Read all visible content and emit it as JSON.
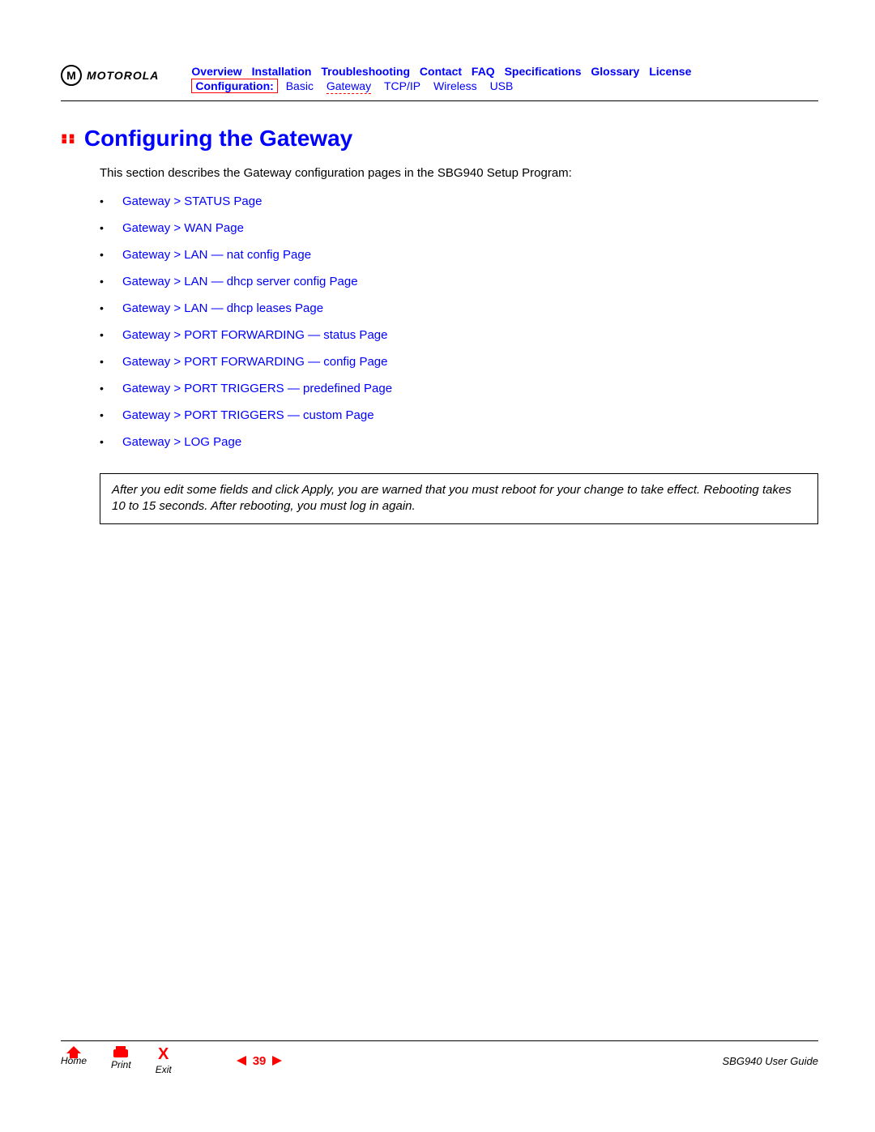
{
  "brand": "MOTOROLA",
  "nav": {
    "row1": [
      "Overview",
      "Installation",
      "Troubleshooting",
      "Contact",
      "FAQ",
      "Specifications",
      "Glossary",
      "License"
    ],
    "config_label": "Configuration:",
    "row2": [
      "Basic",
      "Gateway",
      "TCP/IP",
      "Wireless",
      "USB"
    ],
    "row2_current_index": 1
  },
  "heading": "Configuring the Gateway",
  "intro": "This section describes the Gateway configuration pages in the SBG940 Setup Program:",
  "links": [
    "Gateway > STATUS Page",
    "Gateway > WAN Page",
    "Gateway > LAN — nat config Page",
    "Gateway > LAN — dhcp server config Page",
    "Gateway > LAN — dhcp leases Page",
    "Gateway > PORT FORWARDING — status Page",
    "Gateway > PORT FORWARDING — config Page",
    "Gateway > PORT TRIGGERS — predefined Page",
    "Gateway > PORT TRIGGERS — custom Page",
    "Gateway > LOG Page"
  ],
  "note": "After you edit some fields and click Apply, you are warned that you must reboot for your change to take effect. Rebooting takes 10 to 15 seconds. After rebooting, you must log in again.",
  "footer": {
    "home": "Home",
    "print": "Print",
    "exit": "Exit",
    "page": "39",
    "doc_title": "SBG940 User Guide"
  }
}
